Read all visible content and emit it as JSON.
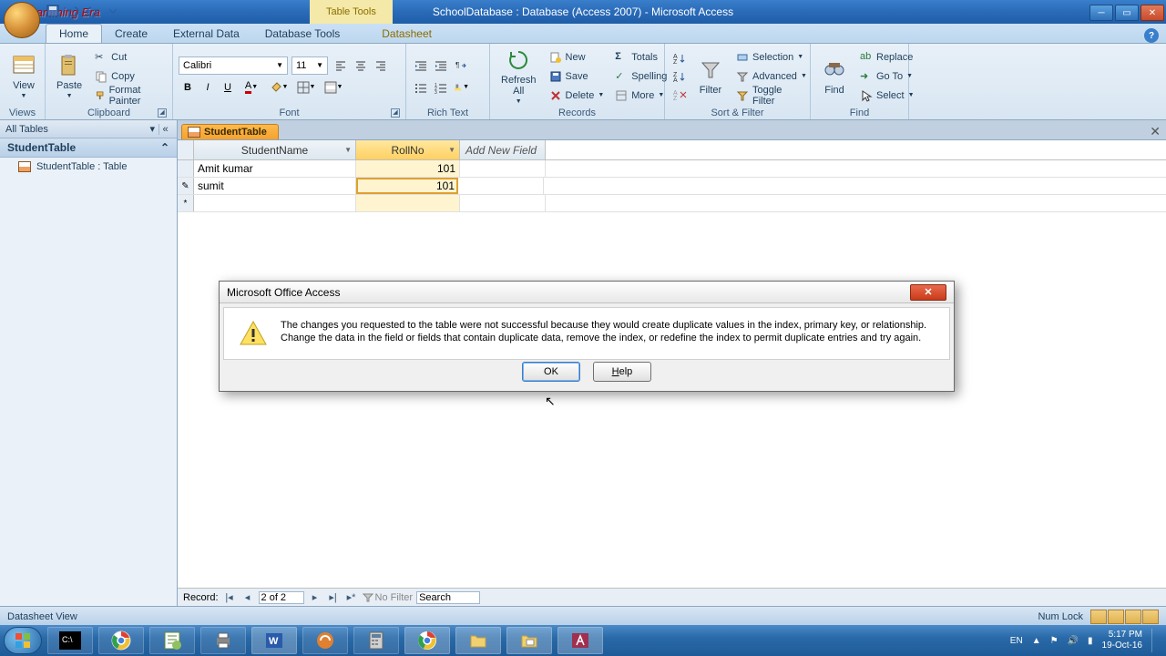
{
  "titlebar": {
    "logo_text": "Programming Era",
    "context_label": "Table Tools",
    "app_title": "SchoolDatabase : Database (Access 2007) - Microsoft Access"
  },
  "ribbon_tabs": {
    "home": "Home",
    "create": "Create",
    "external": "External Data",
    "dbtools": "Database Tools",
    "datasheet": "Datasheet"
  },
  "ribbon": {
    "views": {
      "label": "Views",
      "view": "View"
    },
    "clipboard": {
      "label": "Clipboard",
      "paste": "Paste",
      "cut": "Cut",
      "copy": "Copy",
      "fmt": "Format Painter"
    },
    "font": {
      "label": "Font",
      "name": "Calibri",
      "size": "11"
    },
    "richtext": {
      "label": "Rich Text"
    },
    "records": {
      "label": "Records",
      "refresh": "Refresh All",
      "new": "New",
      "save": "Save",
      "delete": "Delete",
      "totals": "Totals",
      "spelling": "Spelling",
      "more": "More"
    },
    "sortfilter": {
      "label": "Sort & Filter",
      "filter": "Filter",
      "selection": "Selection",
      "advanced": "Advanced",
      "toggle": "Toggle Filter"
    },
    "find": {
      "label": "Find",
      "find": "Find",
      "replace": "Replace",
      "goto": "Go To",
      "select": "Select"
    }
  },
  "nav": {
    "header": "All Tables",
    "group": "StudentTable",
    "item": "StudentTable : Table"
  },
  "document": {
    "tab": "StudentTable",
    "columns": {
      "c0": "StudentName",
      "c1": "RollNo",
      "add": "Add New Field"
    },
    "rows": [
      {
        "name": "Amit kumar",
        "roll": "101"
      },
      {
        "name": "sumit",
        "roll": "101"
      }
    ],
    "record_nav": {
      "label": "Record:",
      "pos": "2 of 2",
      "nofilter": "No Filter",
      "search": "Search"
    }
  },
  "dialog": {
    "title": "Microsoft Office Access",
    "message": "The changes you requested to the table were not successful because they would create duplicate values in the index, primary key, or relationship.  Change the data in the field or fields that contain duplicate data, remove the index, or redefine the index to permit duplicate entries and try again.",
    "ok": "OK",
    "help": "Help"
  },
  "statusbar": {
    "view": "Datasheet View",
    "numlock": "Num Lock"
  },
  "taskbar": {
    "lang": "EN",
    "time": "5:17 PM",
    "date": "19-Oct-16"
  }
}
